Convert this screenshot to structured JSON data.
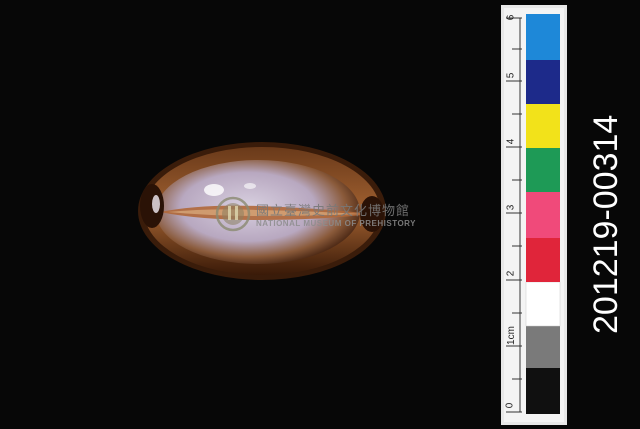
{
  "image": {
    "subject": "shell",
    "background_color": "#070707"
  },
  "watermark": {
    "text_cn": "國立臺灣史前文化博物館",
    "text_en": "NATIONAL MUSEUM OF PREHISTORY",
    "logo_icon": "museum-seal-icon"
  },
  "catalog_number": "201219-00314",
  "scale_bar": {
    "numbers": [
      "0",
      "1cm",
      "2",
      "3",
      "4",
      "5",
      "6"
    ],
    "color_patches": [
      "#101010",
      "#7a7a7a",
      "#ffffff",
      "#e0253a",
      "#f04a7a",
      "#1e9a56",
      "#f2e21a",
      "#1d2a8a",
      "#1e88d8"
    ]
  }
}
